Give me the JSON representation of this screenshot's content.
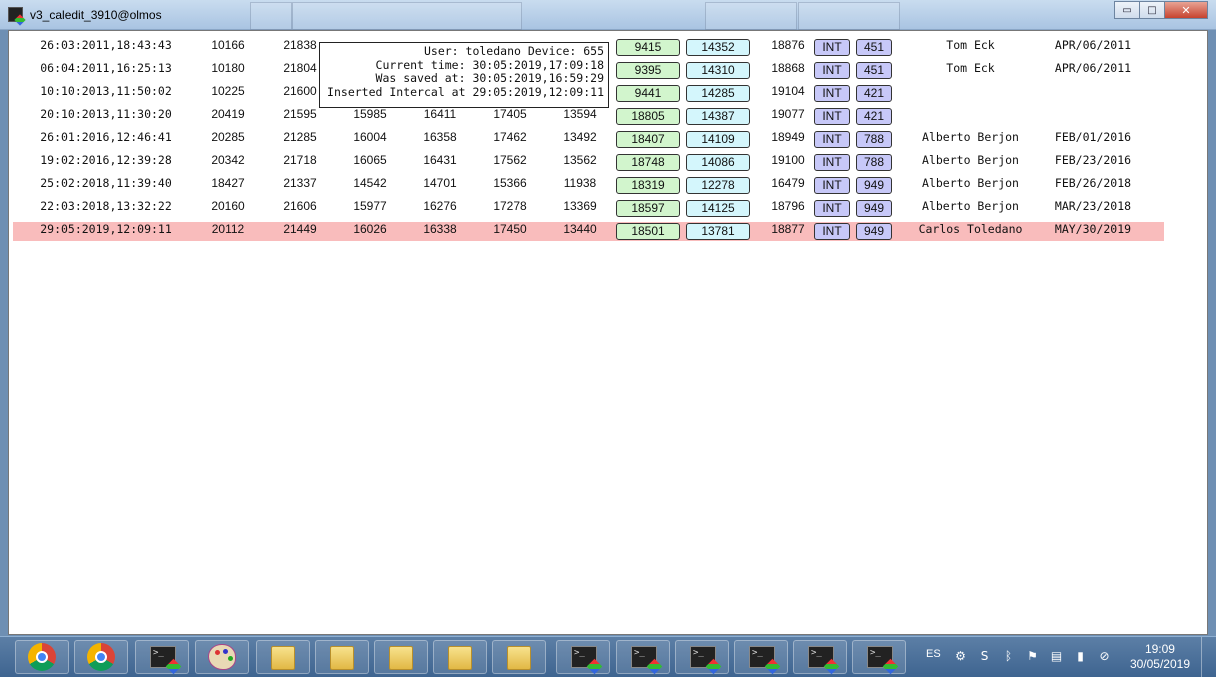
{
  "window": {
    "title": "v3_caledit_3910@olmos",
    "minimize": "▭",
    "maximize": "□",
    "close": "✕"
  },
  "tooltip": {
    "lines": [
      "User: toledano Device: 655",
      "Current time: 30:05:2019,17:09:18",
      "Was saved at: 30:05:2019,16:59:29",
      "Inserted Intercal at 29:05:2019,12:09:11"
    ]
  },
  "rows": [
    {
      "time": "26:03:2011,18:43:43",
      "c1": "10166",
      "c2": "21838",
      "c3": "",
      "c4": "",
      "c5": "",
      "c6": "",
      "g": "9415",
      "cy": "14352",
      "n": "18876",
      "tag": "INT",
      "code": "451",
      "user": "Tom Eck",
      "date": "APR/06/2011",
      "selected": false
    },
    {
      "time": "06:04:2011,16:25:13",
      "c1": "10180",
      "c2": "21804",
      "c3": "",
      "c4": "",
      "c5": "",
      "c6": "",
      "g": "9395",
      "cy": "14310",
      "n": "18868",
      "tag": "INT",
      "code": "451",
      "user": "Tom Eck",
      "date": "APR/06/2011",
      "selected": false
    },
    {
      "time": "10:10:2013,11:50:02",
      "c1": "10225",
      "c2": "21600",
      "c3": "",
      "c4": "",
      "c5": "",
      "c6": "",
      "g": "9441",
      "cy": "14285",
      "n": "19104",
      "tag": "INT",
      "code": "421",
      "user": "",
      "date": "",
      "selected": false
    },
    {
      "time": "20:10:2013,11:30:20",
      "c1": "20419",
      "c2": "21595",
      "c3": "15985",
      "c4": "16411",
      "c5": "17405",
      "c6": "13594",
      "g": "18805",
      "cy": "14387",
      "n": "19077",
      "tag": "INT",
      "code": "421",
      "user": "",
      "date": "",
      "selected": false
    },
    {
      "time": "26:01:2016,12:46:41",
      "c1": "20285",
      "c2": "21285",
      "c3": "16004",
      "c4": "16358",
      "c5": "17462",
      "c6": "13492",
      "g": "18407",
      "cy": "14109",
      "n": "18949",
      "tag": "INT",
      "code": "788",
      "user": "Alberto Berjon",
      "date": "FEB/01/2016",
      "selected": false
    },
    {
      "time": "19:02:2016,12:39:28",
      "c1": "20342",
      "c2": "21718",
      "c3": "16065",
      "c4": "16431",
      "c5": "17562",
      "c6": "13562",
      "g": "18748",
      "cy": "14086",
      "n": "19100",
      "tag": "INT",
      "code": "788",
      "user": "Alberto Berjon",
      "date": "FEB/23/2016",
      "selected": false
    },
    {
      "time": "25:02:2018,11:39:40",
      "c1": "18427",
      "c2": "21337",
      "c3": "14542",
      "c4": "14701",
      "c5": "15366",
      "c6": "11938",
      "g": "18319",
      "cy": "12278",
      "n": "16479",
      "tag": "INT",
      "code": "949",
      "user": "Alberto Berjon",
      "date": "FEB/26/2018",
      "selected": false
    },
    {
      "time": "22:03:2018,13:32:22",
      "c1": "20160",
      "c2": "21606",
      "c3": "15977",
      "c4": "16276",
      "c5": "17278",
      "c6": "13369",
      "g": "18597",
      "cy": "14125",
      "n": "18796",
      "tag": "INT",
      "code": "949",
      "user": "Alberto Berjon",
      "date": "MAR/23/2018",
      "selected": false
    },
    {
      "time": "29:05:2019,12:09:11",
      "c1": "20112",
      "c2": "21449",
      "c3": "16026",
      "c4": "16338",
      "c5": "17450",
      "c6": "13440",
      "g": "18501",
      "cy": "13781",
      "n": "18877",
      "tag": "INT",
      "code": "949",
      "user": "Carlos Toledano",
      "date": "MAY/30/2019",
      "selected": true
    }
  ],
  "taskbar": {
    "apps": [
      {
        "name": "chrome-icon",
        "kind": "chrome"
      },
      {
        "name": "chrome-icon",
        "kind": "chrome"
      },
      {
        "name": "terminal-icon",
        "kind": "term"
      },
      {
        "name": "paint-icon",
        "kind": "paint"
      },
      {
        "name": "folder-icon",
        "kind": "folder"
      },
      {
        "name": "folder-icon",
        "kind": "folder"
      },
      {
        "name": "folder-icon",
        "kind": "folder"
      },
      {
        "name": "folder-icon",
        "kind": "folder"
      },
      {
        "name": "folder-icon",
        "kind": "folder"
      },
      {
        "name": "terminal-icon",
        "kind": "term"
      },
      {
        "name": "terminal-icon",
        "kind": "term"
      },
      {
        "name": "terminal-icon",
        "kind": "term"
      },
      {
        "name": "terminal-icon",
        "kind": "term"
      },
      {
        "name": "terminal-icon",
        "kind": "term"
      },
      {
        "name": "terminal-icon",
        "kind": "term"
      }
    ],
    "language": "ES",
    "tray_icons": [
      {
        "name": "network-icon",
        "glyph": "⚙"
      },
      {
        "name": "skype-icon",
        "glyph": "S"
      },
      {
        "name": "bluetooth-icon",
        "glyph": "ᛒ"
      },
      {
        "name": "flag-icon",
        "glyph": "⚑"
      },
      {
        "name": "clipboard-icon",
        "glyph": "▤"
      },
      {
        "name": "signal-icon",
        "glyph": "▮"
      },
      {
        "name": "volume-muted-icon",
        "glyph": "⊘"
      }
    ],
    "time": "19:09",
    "date": "30/05/2019"
  }
}
